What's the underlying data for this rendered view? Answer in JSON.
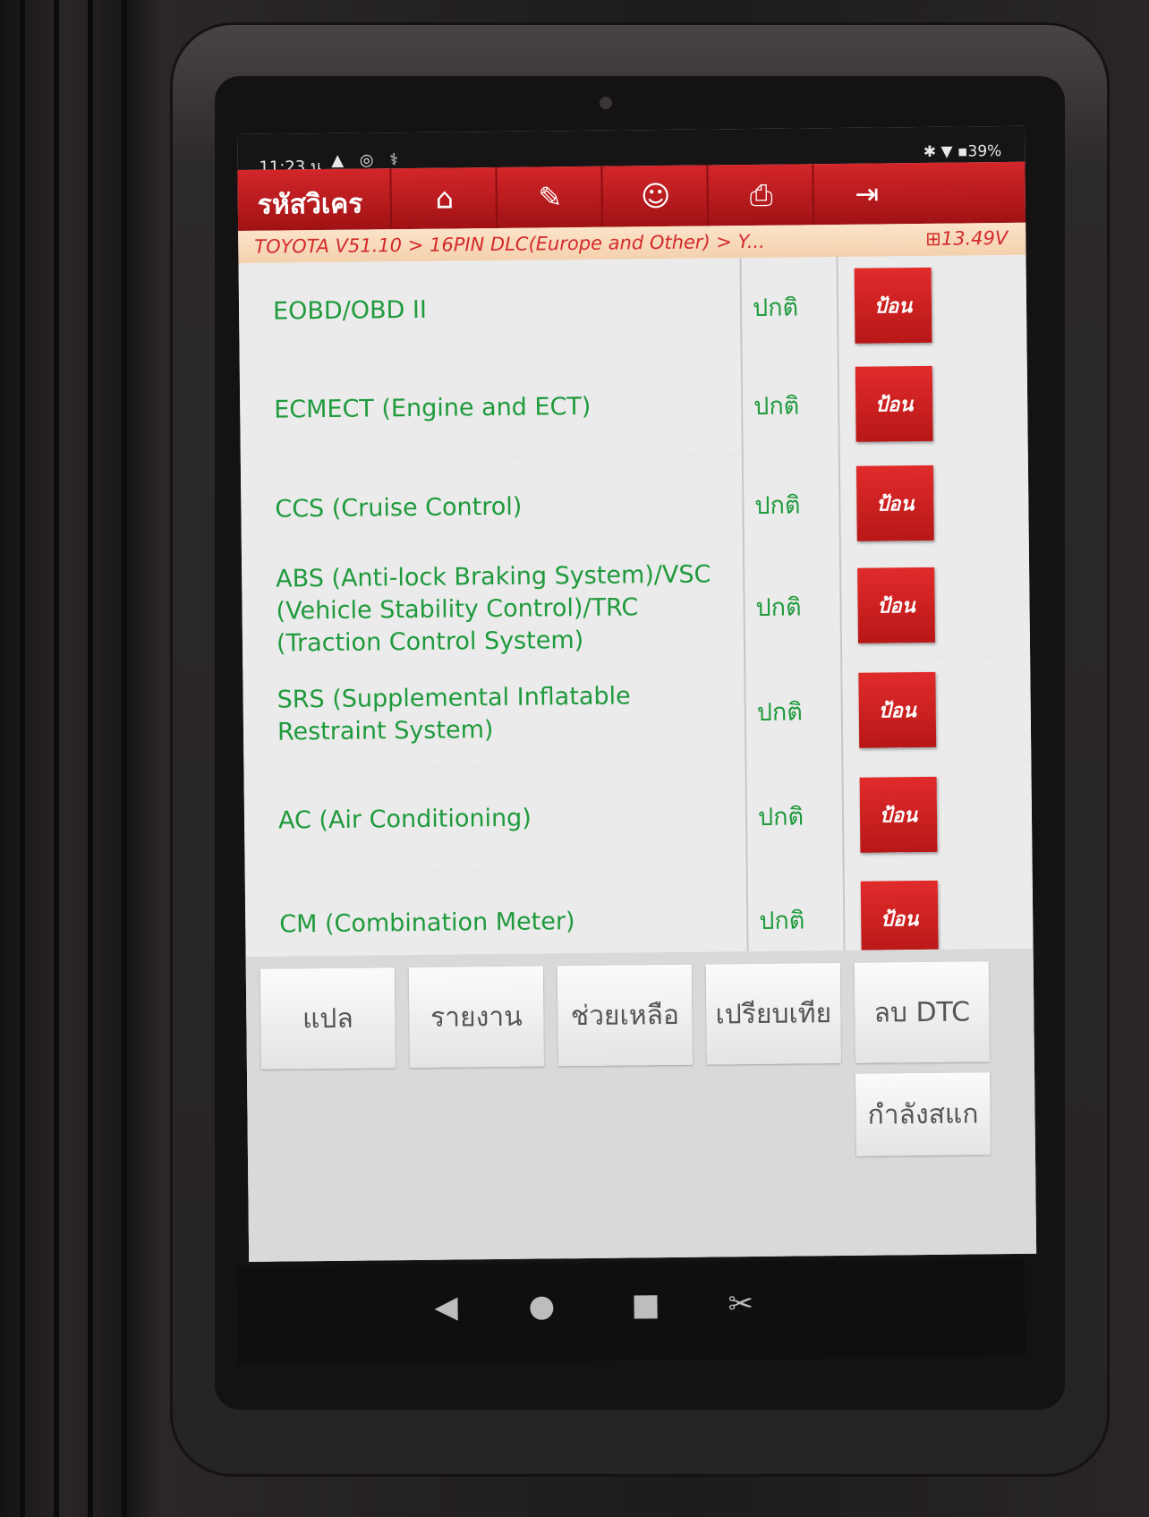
{
  "statusbar": {
    "time": "11:23 น.",
    "left_icons": "▲ ◎ ⚕",
    "right_status": "✱ ▼ ▪39%"
  },
  "toolbar": {
    "title": "รหัสวิเคร",
    "icons": [
      "home-icon",
      "edit-icon",
      "user-support-icon",
      "print-icon",
      "exit-icon"
    ]
  },
  "breadcrumb": {
    "path": "TOYOTA V51.10 > 16PIN DLC(Europe and Other) > Y...",
    "voltage": "13.49V"
  },
  "systems": [
    {
      "name": "EOBD/OBD II",
      "status": "ปกติ",
      "action": "ป้อน"
    },
    {
      "name": "ECMECT (Engine and ECT)",
      "status": "ปกติ",
      "action": "ป้อน"
    },
    {
      "name": "CCS (Cruise Control)",
      "status": "ปกติ",
      "action": "ป้อน"
    },
    {
      "name": "ABS (Anti-lock Braking System)/VSC (Vehicle Stability Control)/TRC (Traction Control System)",
      "status": "ปกติ",
      "action": "ป้อน"
    },
    {
      "name": "SRS (Supplemental Inflatable Restraint System)",
      "status": "ปกติ",
      "action": "ป้อน"
    },
    {
      "name": "AC (Air Conditioning)",
      "status": "ปกติ",
      "action": "ป้อน"
    },
    {
      "name": "CM (Combination Meter)",
      "status": "ปกติ",
      "action": "ป้อน"
    }
  ],
  "buttons": {
    "translate": "แปล",
    "report": "รายงาน",
    "help": "ช่วยเหลือ",
    "compare": "เปรียบเทีย",
    "clear_dtc": "ลบ DTC",
    "scanning": "กำลังสแก"
  },
  "navbar": {
    "back": "◀",
    "home": "●",
    "recent": "■",
    "screenshot": "✂"
  }
}
